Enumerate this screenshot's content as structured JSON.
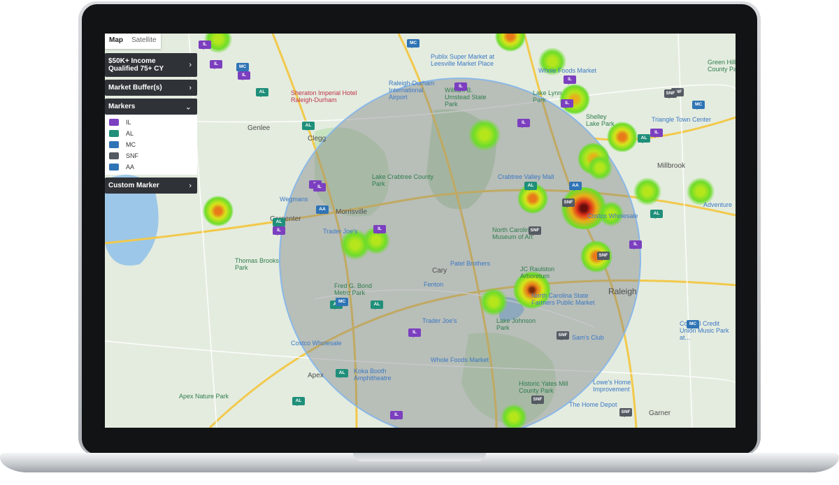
{
  "map_tabs": {
    "map": "Map",
    "satellite": "Satellite"
  },
  "panel": {
    "income_layer": "$50K+ Income Qualified 75+ CY",
    "market_buffer": "Market Buffer(s)",
    "markers_title": "Markers",
    "custom_marker": "Custom Marker",
    "legend": [
      {
        "code": "IL",
        "color": "#7b3fbf"
      },
      {
        "code": "AL",
        "color": "#1f8f7a"
      },
      {
        "code": "MC",
        "color": "#2f74b5"
      },
      {
        "code": "SNF",
        "color": "#545a62"
      },
      {
        "code": "AA",
        "color": "#2f74b5"
      }
    ]
  },
  "places": {
    "genlee": "Genlee",
    "clegg": "Clegg",
    "morrisville": "Morrisville",
    "carpenter": "Carpenter",
    "cary": "Cary",
    "apex": "Apex",
    "raleigh": "Raleigh",
    "garner": "Garner",
    "millbrook": "Millbrook",
    "lake_lynn": "Lake Lynn Park",
    "thomas_brooks": "Thomas Brooks Park",
    "lake_crabtree": "Lake Crabtree County Park",
    "umstead": "William B. Umstead State Park",
    "apex_nature": "Apex Nature Park",
    "shelley": "Shelley Lake Park",
    "fred_bond": "Fred G. Bond Metro Park",
    "lake_johnson": "Lake Johnson Park",
    "historic_yates": "Historic Yates Mill County Park",
    "jc_raulston": "JC Raulston Arboretum",
    "museum_art": "North Carolina Museum of Art",
    "rdu": "Raleigh-Durham International Airport",
    "sheraton": "Sheraton Imperial Hotel Raleigh-Durham",
    "publix": "Publix Super Market at Leesville Market Place",
    "wholefoods1": "Whole Foods Market",
    "crabtree": "Crabtree Valley Mall",
    "wegmans": "Wegmans",
    "traderjoes1": "Trader Joe's",
    "traderjoes2": "Trader Joe's",
    "patel": "Patel Brothers",
    "fenton": "Fenton",
    "costco1": "Costco Wholesale",
    "costco2": "Costco Wholesale",
    "wholefoods2": "Whole Foods Market",
    "koka": "Koka Booth Amphitheatre",
    "ncfarmers": "North Carolina State Farmers Public Market",
    "sams": "Sam's Club",
    "lowes": "Lowe's Home Improvement",
    "homedepot": "The Home Depot",
    "triangle": "Triangle Town Center",
    "adventure": "Adventure",
    "green_hills": "Green Hills County Park",
    "coastal": "Coastal Credit Union Music Park at..."
  },
  "markers": [
    "IL",
    "IL",
    "IL",
    "MC",
    "AL",
    "IL",
    "SNF",
    "IL",
    "AL",
    "IL",
    "AL",
    "AA",
    "MC",
    "IL",
    "AL",
    "IL",
    "SNF",
    "AL",
    "MC",
    "AL",
    "IL",
    "SNF",
    "AL",
    "IL",
    "IL",
    "IL",
    "SNF",
    "SNF",
    "AA",
    "MC",
    "IL",
    "SNF",
    "MC",
    "AL",
    "IL",
    "SNF",
    "IL",
    "AL",
    "SNF",
    "AL"
  ]
}
